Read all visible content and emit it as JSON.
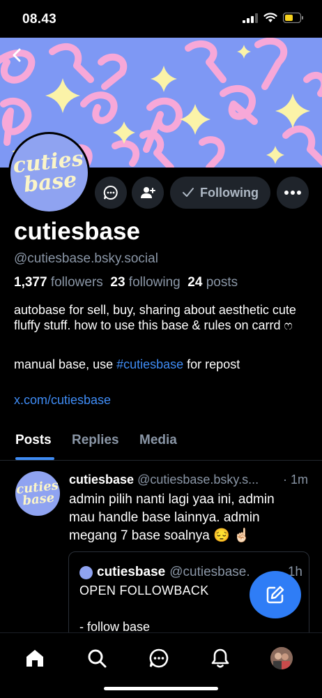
{
  "status_bar": {
    "time": "08.43"
  },
  "banner": {
    "logo_line1": "cuties",
    "logo_line2": "base"
  },
  "profile": {
    "display_name": "cutiesbase",
    "handle": "@cutiesbase.bsky.social",
    "followers_count": "1,377",
    "followers_label": "followers",
    "following_count": "23",
    "following_label": "following",
    "posts_count": "24",
    "posts_label": "posts",
    "bio_line1": "autobase for sell, buy, sharing about aesthetic cute fluffy stuff. how to use this base & rules on carrd ෆ",
    "bio_line2_prefix": "manual base, use ",
    "bio_hashtag": "#cutiesbase",
    "bio_line2_suffix": " for repost",
    "website": "x.com/cutiesbase"
  },
  "actions": {
    "following_label": "Following"
  },
  "tabs": [
    {
      "label": "Posts",
      "active": true
    },
    {
      "label": "Replies",
      "active": false
    },
    {
      "label": "Media",
      "active": false
    }
  ],
  "post": {
    "author_name": "cutiesbase",
    "author_handle": "@cutiesbase.bsky.s...",
    "time": "· 1m",
    "text": "admin pilih nanti lagi yaa ini, admin mau handle base lainnya. admin megang 7 base soalnya 😔 ☝🏻",
    "quote": {
      "author_name": "cutiesbase",
      "author_handle": "@cutiesbase.",
      "time": "1h",
      "line1": "OPEN FOLLOWBACK",
      "line2": "- follow base"
    }
  },
  "colors": {
    "accent": "#3f8cf5",
    "banner": "#7e98f4",
    "ribbon": "#f7a8d8",
    "star": "#fbf3a8"
  }
}
